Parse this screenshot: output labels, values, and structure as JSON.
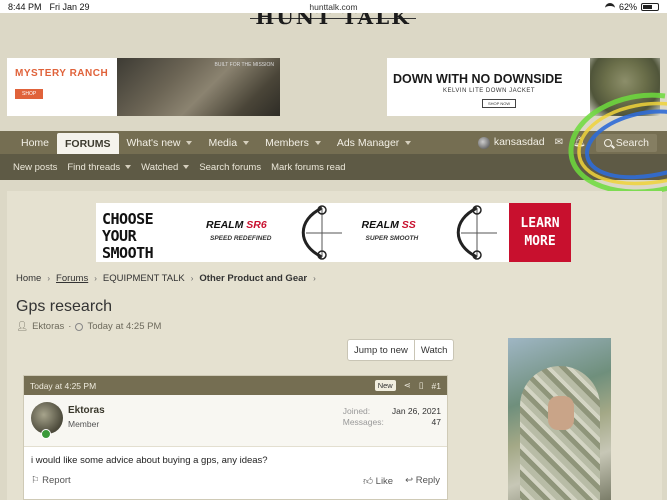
{
  "status_bar": {
    "time": "8:44 PM",
    "date": "Fri Jan 29",
    "url": "hunttalk.com",
    "battery": "62%"
  },
  "site": {
    "logo_text": "HUNT TALK"
  },
  "ads": {
    "left": {
      "brand": "MYSTERY RANCH",
      "cta": "SHOP",
      "tagline": "BUILT FOR THE MISSION"
    },
    "right": {
      "headline": "DOWN WITH NO DOWNSIDE",
      "sub": "KELVIN LITE DOWN JACKET",
      "cta": "SHOP NOW"
    },
    "middle": {
      "left_text": "CHOOSE YOUR SMOOTH",
      "model1_prefix": "REALM ",
      "model1_suffix": "SR6",
      "model1_desc": "SPEED REDEFINED",
      "model2_prefix": "REALM ",
      "model2_suffix": "SS",
      "model2_desc": "SUPER SMOOTH",
      "cta": "LEARN MORE"
    }
  },
  "nav": {
    "items": [
      {
        "label": "Home"
      },
      {
        "label": "FORUMS"
      },
      {
        "label": "What's new"
      },
      {
        "label": "Media"
      },
      {
        "label": "Members"
      },
      {
        "label": "Ads Manager"
      }
    ],
    "username": "kansasdad",
    "search_label": "Search"
  },
  "subnav": {
    "items": [
      "New posts",
      "Find threads",
      "Watched",
      "Search forums",
      "Mark forums read"
    ]
  },
  "breadcrumb": {
    "home": "Home",
    "forums": "Forums",
    "section": "EQUIPMENT TALK",
    "subforum": "Other Product and Gear"
  },
  "thread": {
    "title": "Gps research",
    "author": "Ektoras",
    "time": "Today at 4:25 PM",
    "jump_label": "Jump to new",
    "watch_label": "Watch"
  },
  "post": {
    "time": "Today at 4:25 PM",
    "badge": "New",
    "number": "#1",
    "username": "Ektoras",
    "role": "Member",
    "joined_label": "Joined:",
    "joined_value": "Jan 26, 2021",
    "messages_label": "Messages:",
    "messages_value": "47",
    "body": "i would like some advice about buying a gps, any ideas?",
    "report_label": "Report",
    "like_label": "Like",
    "reply_label": "Reply"
  },
  "colors": {
    "nav_bg": "#756e52",
    "subnav_bg": "#5e5a45",
    "page_bg": "#dcd8c6",
    "accent_red": "#c8102e",
    "brand_orange": "#e0623a"
  }
}
